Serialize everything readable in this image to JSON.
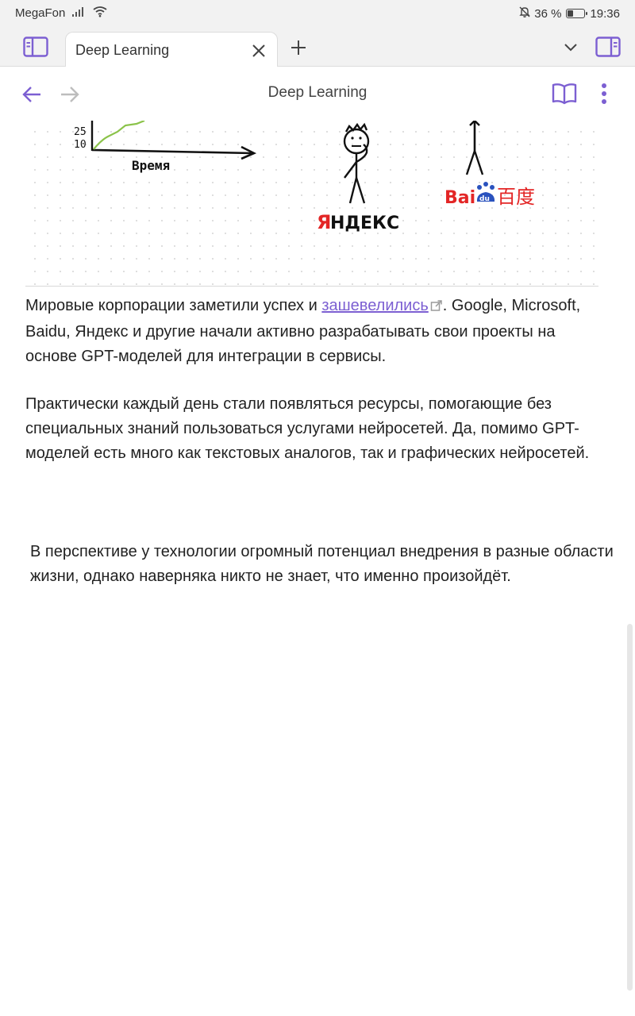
{
  "status": {
    "carrier": "MegaFon",
    "battery_percent": "36 %",
    "battery_level": 0.36,
    "time": "19:36"
  },
  "tabbar": {
    "tab_title": "Deep Learning"
  },
  "nav": {
    "title": "Deep Learning"
  },
  "sketch": {
    "axis_tick_top": "25",
    "axis_tick_bottom": "10",
    "axis_label": "Время",
    "yandex_logo": "ЯНДЕКС",
    "baidu_latin": "Bai",
    "baidu_du": "du",
    "baidu_chinese": "百度"
  },
  "content": {
    "para1_before": "Мировые корпорации заметили успех и ",
    "para1_link": "зашевелились",
    "para1_after": ". Google, Microsoft, Baidu, Яндекс и другие начали активно разрабатывать свои проекты на основе GPT-моделей для интеграции в сервисы.",
    "para2": "Практически каждый день стали появляться ресурсы, помогающие без специальных знаний пользоваться услугами нейросетей. Да, помимо GPT-моделей есть много как текстовых аналогов, так и графических нейросетей.",
    "para3": "В перспективе у технологии огромный потенциал внедрения в разные области жизни, однако наверняка никто не знает, что именно произойдёт."
  },
  "colors": {
    "accent": "#7c5fd2",
    "yandex_red": "#e32626",
    "sketch_green": "#8bc34a"
  }
}
